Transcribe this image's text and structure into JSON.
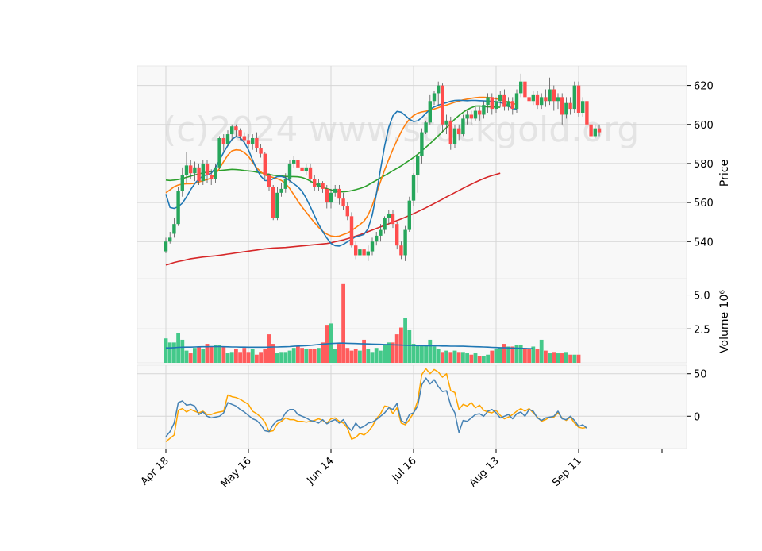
{
  "chart_data": {
    "type": "candlestick",
    "watermark": "(c)2024 www.stockgold.org",
    "x_tick_labels": [
      "Apr 18",
      "May 16",
      "Jun 14",
      "Jul 16",
      "Aug 13",
      "Sep 11"
    ],
    "x_tick_index": [
      0,
      20,
      40,
      60,
      80,
      100
    ],
    "colors": {
      "up": "#26a65b",
      "down": "#ff4d4d",
      "ma_blue": "#1f77b4",
      "ma_orange": "#ff7f0e",
      "ma_green": "#2ca02c",
      "ma_red": "#d62728",
      "osc_blue": "#4682b4",
      "osc_orange": "#ffa500"
    },
    "price_panel": {
      "ylabel": "Price",
      "ylim": [
        521,
        630
      ],
      "y_ticks": [
        540,
        560,
        580,
        600,
        620
      ],
      "candles": [
        [
          535,
          540,
          542,
          534
        ],
        [
          540,
          542,
          545,
          539
        ],
        [
          544,
          549,
          552,
          542
        ],
        [
          549,
          566,
          568,
          548
        ],
        [
          566,
          574,
          578,
          563
        ],
        [
          574,
          579,
          586,
          570
        ],
        [
          579,
          575,
          582,
          572
        ],
        [
          575,
          578,
          581,
          571
        ],
        [
          578,
          571,
          580,
          569
        ],
        [
          571,
          580,
          582,
          569
        ],
        [
          580,
          574,
          582,
          570
        ],
        [
          574,
          572,
          577,
          569
        ],
        [
          572,
          578,
          580,
          570
        ],
        [
          578,
          593,
          594,
          577
        ],
        [
          593,
          590,
          595,
          586
        ],
        [
          590,
          595,
          597,
          589
        ],
        [
          595,
          599,
          600,
          592
        ],
        [
          599,
          597,
          600,
          594
        ],
        [
          597,
          594,
          598,
          592
        ],
        [
          594,
          592,
          596,
          590
        ],
        [
          592,
          590,
          595,
          588
        ],
        [
          590,
          593,
          595,
          587
        ],
        [
          593,
          588,
          596,
          586
        ],
        [
          588,
          585,
          590,
          583
        ],
        [
          585,
          574,
          586,
          572
        ],
        [
          574,
          568,
          575,
          566
        ],
        [
          568,
          552,
          569,
          551
        ],
        [
          552,
          565,
          568,
          551
        ],
        [
          565,
          567,
          570,
          563
        ],
        [
          567,
          572,
          575,
          565
        ],
        [
          572,
          580,
          582,
          570
        ],
        [
          580,
          582,
          584,
          578
        ],
        [
          582,
          578,
          583,
          576
        ],
        [
          578,
          576,
          580,
          574
        ],
        [
          576,
          578,
          580,
          574
        ],
        [
          578,
          572,
          580,
          570
        ],
        [
          572,
          568,
          574,
          566
        ],
        [
          568,
          570,
          572,
          566
        ],
        [
          570,
          567,
          571,
          565
        ],
        [
          567,
          560,
          569,
          557
        ],
        [
          560,
          565,
          567,
          557
        ],
        [
          565,
          567,
          569,
          563
        ],
        [
          567,
          562,
          569,
          559
        ],
        [
          562,
          558,
          565,
          556
        ],
        [
          558,
          553,
          560,
          551
        ],
        [
          553,
          538,
          555,
          537
        ],
        [
          538,
          533,
          540,
          531
        ],
        [
          533,
          536,
          538,
          532
        ],
        [
          536,
          533,
          539,
          531
        ],
        [
          533,
          535,
          538,
          530
        ],
        [
          535,
          540,
          542,
          533
        ],
        [
          540,
          543,
          545,
          538
        ],
        [
          543,
          546,
          549,
          540
        ],
        [
          546,
          552,
          553,
          544
        ],
        [
          552,
          554,
          556,
          549
        ],
        [
          554,
          549,
          556,
          547
        ],
        [
          549,
          538,
          550,
          536
        ],
        [
          538,
          533,
          540,
          531
        ],
        [
          533,
          546,
          548,
          530
        ],
        [
          546,
          561,
          563,
          545
        ],
        [
          561,
          574,
          575,
          558
        ],
        [
          574,
          584,
          585,
          565
        ],
        [
          584,
          596,
          598,
          580
        ],
        [
          596,
          601,
          602,
          595
        ],
        [
          601,
          612,
          615,
          600
        ],
        [
          612,
          616,
          617,
          610
        ],
        [
          616,
          620,
          622,
          610
        ],
        [
          620,
          600,
          621,
          596
        ],
        [
          600,
          602,
          605,
          595
        ],
        [
          602,
          590,
          604,
          587
        ],
        [
          590,
          598,
          600,
          588
        ],
        [
          598,
          595,
          600,
          592
        ],
        [
          595,
          603,
          605,
          594
        ],
        [
          603,
          605,
          607,
          600
        ],
        [
          605,
          603,
          607,
          600
        ],
        [
          603,
          607,
          609,
          602
        ],
        [
          607,
          605,
          609,
          602
        ],
        [
          605,
          610,
          612,
          603
        ],
        [
          610,
          614,
          616,
          606
        ],
        [
          614,
          608,
          616,
          605
        ],
        [
          608,
          612,
          614,
          606
        ],
        [
          612,
          615,
          617,
          609
        ],
        [
          615,
          609,
          618,
          607
        ],
        [
          609,
          612,
          614,
          607
        ],
        [
          612,
          608,
          614,
          605
        ],
        [
          608,
          616,
          618,
          606
        ],
        [
          616,
          622,
          626,
          614
        ],
        [
          622,
          614,
          624,
          612
        ],
        [
          614,
          612,
          617,
          609
        ],
        [
          612,
          615,
          617,
          610
        ],
        [
          615,
          610,
          617,
          608
        ],
        [
          610,
          614,
          616,
          608
        ],
        [
          614,
          612,
          618,
          609
        ],
        [
          612,
          618,
          624,
          610
        ],
        [
          618,
          612,
          620,
          607
        ],
        [
          612,
          614,
          616,
          608
        ],
        [
          614,
          605,
          616,
          600
        ],
        [
          605,
          611,
          614,
          603
        ],
        [
          611,
          608,
          614,
          605
        ],
        [
          608,
          620,
          622,
          606
        ],
        [
          620,
          606,
          622,
          604
        ],
        [
          606,
          612,
          614,
          604
        ],
        [
          612,
          600,
          614,
          598
        ],
        [
          600,
          594,
          602,
          592
        ],
        [
          594,
          598,
          600,
          593
        ],
        [
          598,
          596,
          600,
          594
        ]
      ],
      "ma_blue": [
        564.3,
        557.5,
        557.0,
        557.9,
        559.7,
        562.9,
        566.6,
        569.7,
        572.1,
        573.6,
        574.3,
        575.0,
        577.8,
        581.7,
        585.7,
        589.2,
        592.3,
        593.8,
        593.2,
        590.8,
        587.0,
        581.8,
        577.0,
        573.5,
        571.3,
        571.2,
        572.2,
        573.3,
        573.4,
        572.7,
        571.2,
        569.6,
        568.0,
        565.7,
        562.2,
        557.9,
        553.3,
        549.0,
        545.1,
        541.8,
        539.1,
        537.9,
        537.7,
        538.6,
        539.9,
        541.2,
        542.5,
        543.0,
        543.7,
        546.7,
        553.7,
        564.4,
        577.0,
        589.0,
        598.6,
        604.4,
        606.7,
        606.3,
        604.6,
        602.7,
        601.5,
        601.9,
        603.5,
        605.7,
        607.7,
        609.0,
        609.9,
        610.6,
        611.2,
        611.9,
        612.3,
        612.4,
        612.3,
        612.2,
        612.3,
        612.3,
        612.2,
        612.1,
        612.0,
        611.8,
        611.6,
        611.3,
        610.6,
        609.4,
        608.1,
        607.9
      ],
      "ma_orange": [
        565.0,
        566.5,
        568.1,
        569.0,
        569.5,
        569.6,
        569.6,
        569.9,
        570.5,
        571.2,
        571.8,
        572.6,
        574.5,
        577.5,
        581.0,
        584.3,
        586.5,
        587.0,
        586.8,
        585.6,
        583.7,
        580.6,
        577.8,
        575.7,
        574.1,
        573.4,
        572.8,
        572.2,
        571.3,
        569.7,
        567.2,
        564.0,
        560.7,
        557.7,
        555.0,
        552.3,
        549.7,
        547.3,
        545.3,
        543.8,
        542.9,
        542.6,
        542.8,
        543.6,
        544.4,
        545.7,
        547.2,
        548.7,
        550.5,
        553.6,
        558.5,
        564.6,
        570.8,
        576.7,
        582.1,
        587.2,
        591.9,
        596.2,
        599.9,
        602.7,
        604.6,
        605.8,
        606.4,
        606.8,
        607.3,
        607.9,
        608.6,
        609.3,
        610.0,
        610.7,
        611.4,
        612.0,
        612.6,
        613.0,
        613.4,
        613.7,
        613.9,
        613.9,
        613.8,
        613.6,
        613.2,
        612.7,
        612.1,
        611.5,
        610.9,
        610.2
      ],
      "ma_green": [
        571.5,
        571.3,
        571.5,
        571.8,
        572.3,
        572.9,
        573.5,
        574.1,
        574.6,
        575.2,
        575.6,
        575.9,
        576.2,
        576.4,
        576.6,
        576.8,
        577.0,
        576.9,
        576.7,
        576.4,
        576.2,
        576.0,
        575.6,
        575.2,
        574.9,
        574.4,
        574.0,
        573.8,
        573.6,
        573.4,
        573.3,
        573.3,
        573.2,
        572.8,
        572.1,
        571.0,
        569.8,
        568.7,
        567.9,
        567.1,
        566.5,
        565.8,
        565.5,
        565.5,
        565.7,
        566.1,
        566.6,
        567.2,
        567.9,
        569.0,
        570.2,
        571.4,
        572.6,
        573.8,
        575.0,
        576.3,
        577.5,
        578.8,
        580.2,
        581.6,
        583.1,
        584.7,
        586.5,
        588.3,
        590.2,
        592.2,
        594.2,
        596.3,
        598.4,
        600.6,
        602.7,
        604.6,
        606.2,
        607.6,
        608.6,
        609.4,
        609.5,
        609.2,
        609.0,
        609.0,
        608.9,
        608.8
      ],
      "ma_red": [
        528.0,
        528.6,
        529.3,
        529.8,
        530.2,
        530.7,
        531.2,
        531.5,
        531.8,
        532.1,
        532.3,
        532.5,
        532.7,
        533.0,
        533.3,
        533.6,
        533.9,
        534.2,
        534.5,
        534.8,
        535.1,
        535.4,
        535.7,
        536.0,
        536.3,
        536.5,
        536.7,
        536.8,
        536.9,
        537.0,
        537.2,
        537.4,
        537.6,
        537.8,
        538.0,
        538.2,
        538.4,
        538.6,
        538.8,
        539.0,
        539.4,
        539.9,
        540.4,
        540.9,
        541.5,
        542.1,
        542.8,
        543.5,
        544.3,
        545.1,
        545.9,
        546.7,
        547.5,
        548.3,
        549.1,
        550.0,
        550.8,
        551.6,
        552.5,
        553.4,
        554.3,
        555.3,
        556.3,
        557.3,
        558.4,
        559.5,
        560.6,
        561.7,
        562.9,
        564.0,
        565.1,
        566.2,
        567.3,
        568.4,
        569.4,
        570.4,
        571.4,
        572.3,
        573.1,
        573.8,
        574.4,
        575.0
      ]
    },
    "volume_panel": {
      "ylabel": "Volume  10⁶",
      "ylim": [
        0,
        6.2
      ],
      "y_ticks": [
        2.5,
        5.0
      ],
      "y_tick_labels": [
        "2.5",
        "5.0"
      ],
      "values": [
        1.8,
        1.5,
        1.5,
        2.2,
        1.7,
        0.9,
        0.7,
        1.1,
        1.2,
        1.0,
        1.4,
        1.2,
        1.3,
        1.3,
        1.2,
        0.7,
        0.8,
        1.0,
        0.8,
        1.1,
        0.8,
        1.0,
        0.6,
        0.8,
        1.0,
        2.1,
        1.4,
        0.7,
        0.8,
        0.8,
        0.9,
        1.1,
        1.2,
        1.1,
        1.0,
        1.0,
        1.0,
        1.1,
        1.5,
        2.8,
        2.9,
        1.0,
        1.4,
        5.8,
        1.1,
        0.9,
        1.0,
        0.9,
        1.7,
        1.0,
        0.8,
        1.1,
        0.9,
        1.3,
        1.5,
        1.5,
        2.1,
        2.6,
        3.3,
        2.4,
        1.4,
        1.3,
        1.3,
        1.3,
        1.7,
        1.2,
        1.0,
        0.8,
        0.9,
        0.8,
        0.9,
        0.8,
        0.8,
        0.7,
        0.6,
        0.7,
        0.5,
        0.5,
        0.6,
        0.9,
        1.0,
        1.1,
        1.4,
        1.2,
        1.2,
        1.3,
        1.3,
        1.1,
        1.0,
        1.2,
        1.0,
        1.7,
        0.9,
        0.7,
        0.8,
        0.7,
        0.7,
        0.8,
        0.6,
        0.6,
        0.6
      ],
      "avg": [
        1.1,
        1.1,
        1.12,
        1.14,
        1.15,
        1.16,
        1.16,
        1.17,
        1.18,
        1.19,
        1.19,
        1.2,
        1.2,
        1.2,
        1.19,
        1.18,
        1.17,
        1.17,
        1.16,
        1.16,
        1.15,
        1.15,
        1.15,
        1.15,
        1.15,
        1.16,
        1.17,
        1.17,
        1.18,
        1.19,
        1.2,
        1.22,
        1.24,
        1.25,
        1.27,
        1.29,
        1.32,
        1.35,
        1.38,
        1.4,
        1.42,
        1.44,
        1.45,
        1.45,
        1.44,
        1.43,
        1.42,
        1.41,
        1.4,
        1.39,
        1.38,
        1.37,
        1.36,
        1.35,
        1.34,
        1.33,
        1.32,
        1.31,
        1.3,
        1.29,
        1.28,
        1.27,
        1.27,
        1.26,
        1.26,
        1.25,
        1.25,
        1.24,
        1.24,
        1.23,
        1.23,
        1.22,
        1.22,
        1.21,
        1.2,
        1.19,
        1.18,
        1.17,
        1.16,
        1.14,
        1.13,
        1.12,
        1.11,
        1.1,
        1.09,
        1.08,
        1.07,
        1.06,
        1.05,
        1.04
      ]
    },
    "oscillator_panel": {
      "ylim": [
        -38,
        60
      ],
      "y_ticks": [
        0,
        50
      ],
      "y_tick_labels": [
        "0",
        "50"
      ],
      "blue": [
        -24,
        -18,
        -8,
        16,
        18,
        13,
        14,
        12,
        2,
        5,
        0,
        -2,
        -1,
        0,
        4,
        16,
        14,
        12,
        8,
        5,
        1,
        -3,
        -5,
        -10,
        -17,
        -18,
        -10,
        -5,
        -4,
        4,
        8,
        8,
        2,
        0,
        -2,
        -5,
        -6,
        -8,
        -4,
        -9,
        -6,
        -4,
        -8,
        -4,
        -12,
        -17,
        -8,
        -14,
        -12,
        -8,
        -7,
        -4,
        0,
        4,
        10,
        8,
        15,
        -5,
        -8,
        2,
        4,
        12,
        37,
        45,
        38,
        43,
        35,
        29,
        30,
        13,
        4,
        -19,
        -5,
        -6,
        -2,
        2,
        3,
        0,
        6,
        8,
        4,
        -2,
        0,
        2,
        -3,
        3,
        5,
        0,
        8,
        6,
        -2,
        -5,
        -2,
        -1,
        0,
        6,
        -3,
        -4,
        0,
        -5,
        -12,
        -10,
        -14
      ],
      "orange": [
        -30,
        -26,
        -22,
        7,
        9,
        5,
        8,
        6,
        4,
        6,
        2,
        2,
        4,
        5,
        6,
        25,
        23,
        22,
        20,
        17,
        14,
        6,
        3,
        -1,
        -7,
        -18,
        -17,
        -9,
        -6,
        -2,
        -4,
        -4,
        -6,
        -6,
        -7,
        -6,
        -5,
        -3,
        -5,
        -8,
        -3,
        -2,
        -6,
        -8,
        -14,
        -27,
        -25,
        -20,
        -22,
        -18,
        -12,
        -3,
        3,
        12,
        11,
        3,
        10,
        -8,
        -10,
        -4,
        4,
        18,
        49,
        56,
        50,
        55,
        52,
        46,
        50,
        30,
        28,
        8,
        14,
        12,
        16,
        10,
        13,
        7,
        5,
        4,
        7,
        1,
        -3,
        -1,
        2,
        6,
        9,
        6,
        9,
        4,
        -1,
        -6,
        -4,
        -1,
        -1,
        4,
        -2,
        -5,
        -1,
        -8,
        -13,
        -14,
        -13
      ]
    }
  }
}
